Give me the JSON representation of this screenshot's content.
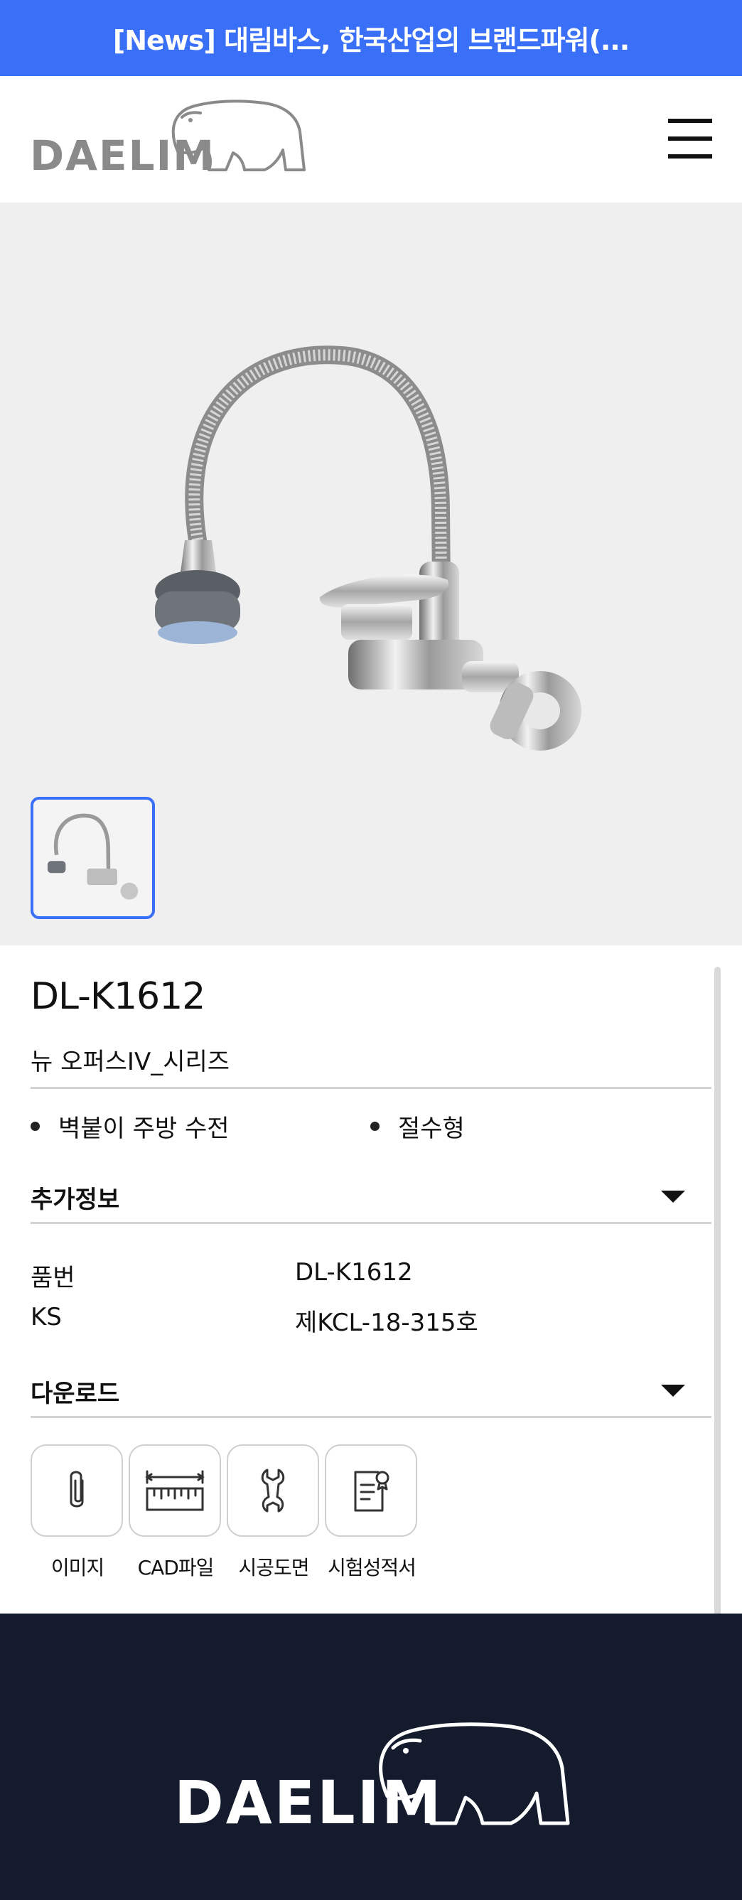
{
  "news_bar": {
    "text": "[News] 대림바스, 한국산업의 브랜드파워(..."
  },
  "header": {
    "logo_text": "DAELIM",
    "menu_icon": "hamburger-menu-icon"
  },
  "product": {
    "code": "DL-K1612",
    "series": "뉴 오퍼스IV_시리즈",
    "features": [
      "벽붙이 주방 수전",
      "절수형"
    ]
  },
  "additional_info": {
    "title": "추가정보",
    "rows": [
      {
        "label": "품번",
        "value": "DL-K1612"
      },
      {
        "label": "KS",
        "value": "제KCL-18-315호"
      }
    ]
  },
  "download": {
    "title": "다운로드",
    "items": [
      {
        "label": "이미지",
        "icon": "paperclip-icon"
      },
      {
        "label": "CAD파일",
        "icon": "ruler-icon"
      },
      {
        "label": "시공도면",
        "icon": "wrench-icon"
      },
      {
        "label": "시험성적서",
        "icon": "certificate-document-icon"
      }
    ]
  },
  "footer": {
    "logo_text": "DAELIM"
  },
  "colors": {
    "accent": "#3a6ff7",
    "footer_bg": "#141b2d",
    "gallery_bg": "#efefef"
  }
}
